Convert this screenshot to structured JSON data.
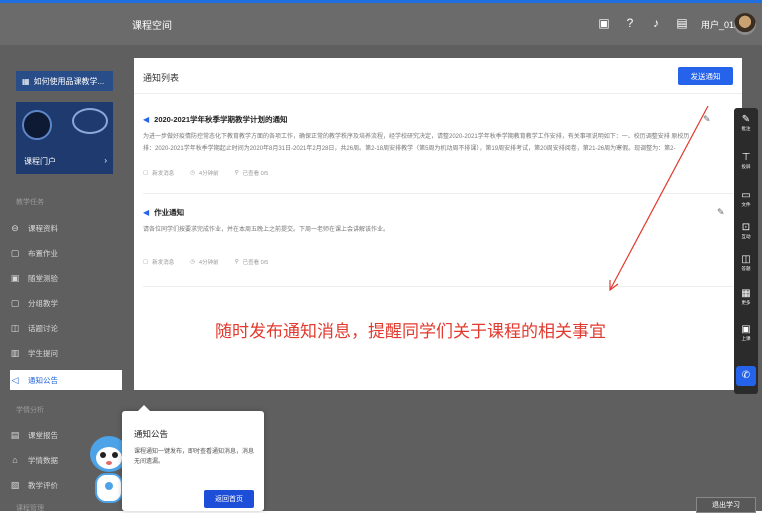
{
  "header": {
    "app_title": "课程空间",
    "icons": [
      "screen-icon",
      "help-icon",
      "bell-icon",
      "message-icon"
    ],
    "username": "用户_0113"
  },
  "sidebar": {
    "help_link": "如何使用品课教学...",
    "course_portal": "课程门户",
    "section_teaching": "教学任务",
    "items_teaching": [
      {
        "label": "课程资料",
        "icon": "folder-icon"
      },
      {
        "label": "布置作业",
        "icon": "clipboard-icon"
      },
      {
        "label": "随堂测验",
        "icon": "quiz-icon"
      },
      {
        "label": "分组教学",
        "icon": "group-icon"
      },
      {
        "label": "话题讨论",
        "icon": "chat-icon"
      },
      {
        "label": "学生提问",
        "icon": "question-icon"
      },
      {
        "label": "通知公告",
        "icon": "megaphone-icon"
      }
    ],
    "section_analysis": "学情分析",
    "items_analysis": [
      {
        "label": "课堂报告",
        "icon": "report-icon"
      },
      {
        "label": "学情数据",
        "icon": "data-icon"
      },
      {
        "label": "教学评价",
        "icon": "evaluate-icon"
      }
    ],
    "section_course": "课程管理"
  },
  "main": {
    "title": "通知列表",
    "send_button": "发送通知",
    "notices": [
      {
        "title": "2020-2021学年秋季学期教学计划的通知",
        "body_line1": "为进一步做好疫情防控常态化下教育教学方面的各项工作，确保正常的教学秩序及培养流程，经学校研究决定，请整2020-2021学年秋季学期教育教学工作安排，有关事项说明如下：一、校历调整安排 原校历",
        "body_line2": "排：2020-2021学年秋季学期起止时间为2020年8月31日-2021年2月28日，共26周。第2-18周安排教学（第5周为机动周不排课），第19周安排考试，第20周安排阅卷，第21-26周为寒假。现调整为：第2-",
        "meta_type": "新发消息",
        "meta_time": "4分钟前",
        "meta_read": "已查看 0/5"
      },
      {
        "title": "作业通知",
        "body_line1": "请各位同学们按要求完成作业，并在本周五晚上之前提交。下周一老师在课上会讲解该作业。",
        "meta_type": "新发消息",
        "meta_time": "4分钟前",
        "meta_read": "已查看 0/5"
      }
    ]
  },
  "annotation": "随时发布通知消息，提醒同学们关于课程的相关事宜",
  "toolbar": [
    {
      "label": "批注",
      "icon": "pen-icon"
    },
    {
      "label": "投屏",
      "icon": "cast-icon"
    },
    {
      "label": "文件",
      "icon": "file-icon"
    },
    {
      "label": "互动",
      "icon": "interact-icon"
    },
    {
      "label": "答题",
      "icon": "answer-icon"
    },
    {
      "label": "更多",
      "icon": "more-grid-icon"
    },
    {
      "label": "上课",
      "icon": "class-icon"
    }
  ],
  "tooltip": {
    "title": "通知公告",
    "desc": "课程通知一键发布，即时查看通知消息，消息无间遗漏。",
    "button": "返回首页"
  },
  "exit_button": "退出学习",
  "colors": {
    "accent": "#2563eb",
    "annotation": "#e23a2e",
    "overlay": "#5f5f5f"
  }
}
